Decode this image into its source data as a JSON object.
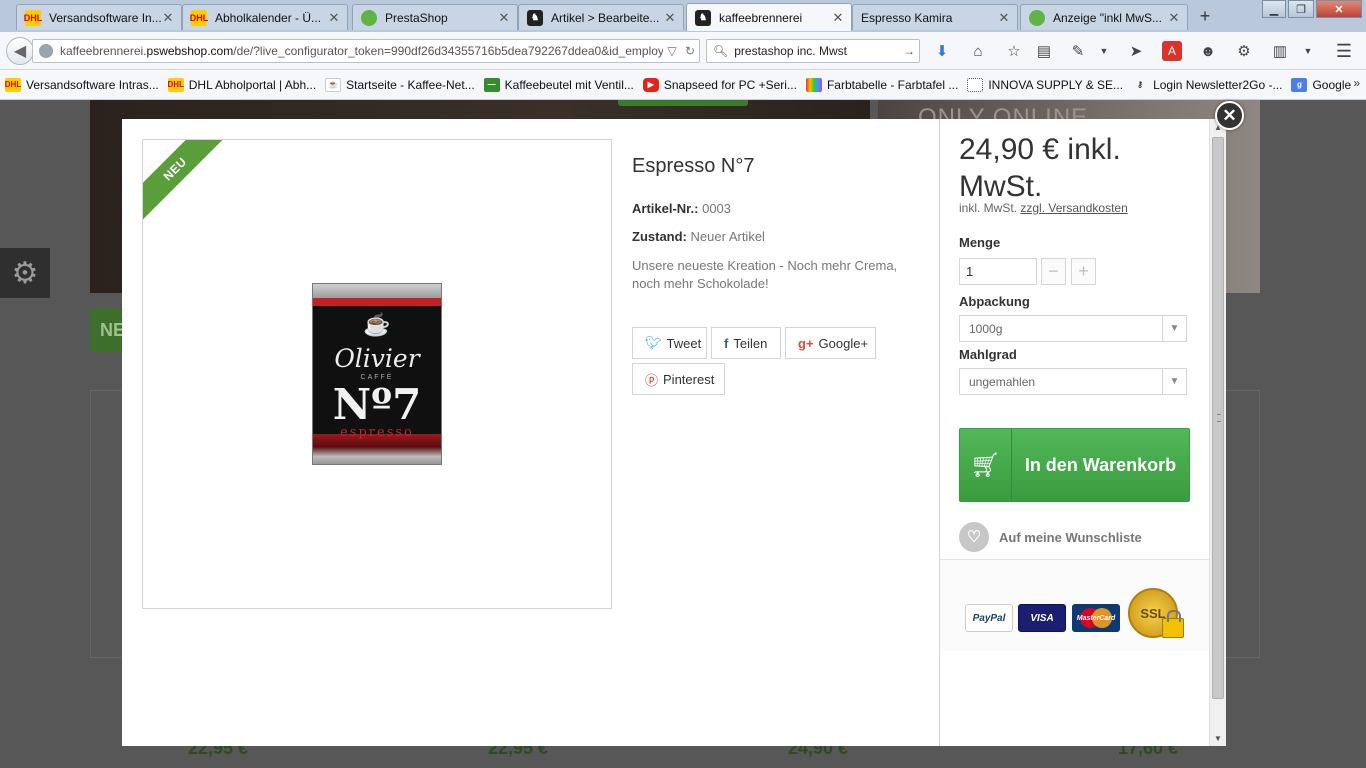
{
  "browser": {
    "tabs": [
      {
        "label": "Versandsoftware In...",
        "icon": "dhl",
        "active": false
      },
      {
        "label": "Abholkalender - Ü...",
        "icon": "dhl",
        "active": false
      },
      {
        "label": "PrestaShop",
        "icon": "ps",
        "active": false
      },
      {
        "label": "Artikel > Bearbeite...",
        "icon": "kb",
        "active": false
      },
      {
        "label": "kaffeebrennerei",
        "icon": "kb",
        "active": true
      },
      {
        "label": "Espresso Kamira",
        "icon": "",
        "active": false
      },
      {
        "label": "Anzeige \"inkl MwS...",
        "icon": "ps",
        "active": false
      }
    ],
    "url_domain": "kaffeebrennerei.",
    "url_host": "pswebshop.com",
    "url_path": "/de/?live_configurator_token=990df26d34355716b5dea792267ddea0&id_employe",
    "search_value": "prestashop inc. Mwst",
    "bookmarks": [
      {
        "label": "Versandsoftware Intras...",
        "icon": "dhl"
      },
      {
        "label": "DHL Abholportal | Abh...",
        "icon": "dhl"
      },
      {
        "label": "Startseite - Kaffee-Net...",
        "icon": "cup"
      },
      {
        "label": "Kaffeebeutel mit Ventil...",
        "icon": "grn"
      },
      {
        "label": "Snapseed for PC +Seri...",
        "icon": "yt"
      },
      {
        "label": "Farbtabelle - Farbtafel ...",
        "icon": "rb"
      },
      {
        "label": "INNOVA SUPPLY & SE...",
        "icon": "box"
      },
      {
        "label": "Login Newsletter2Go -...",
        "icon": "key"
      },
      {
        "label": "Google",
        "icon": "g"
      }
    ]
  },
  "background": {
    "online_text": "ONLY ONLINE",
    "neu_text": "NE",
    "prices": [
      "22,95 €",
      "22,95 €",
      "24,90 €",
      "17,60 €"
    ]
  },
  "product": {
    "badge": "NEU",
    "title": "Espresso N°7",
    "ref_label": "Artikel-Nr.:",
    "ref_value": "0003",
    "condition_label": "Zustand:",
    "condition_value": "Neuer Artikel",
    "description": "Unsere neueste Kreation - Noch mehr Crema, noch mehr Schokolade!",
    "tin": {
      "brand": "Olivier",
      "caffe": "CAFFÈ",
      "number": "Nº7",
      "variety": "espresso"
    },
    "share": {
      "tweet": "Tweet",
      "share": "Teilen",
      "google": "Google+",
      "pinterest": "Pinterest"
    }
  },
  "buybox": {
    "price": "24,90 € inkl. MwSt.",
    "tax_text": "inkl. MwSt.",
    "shipping_link": "zzgl. Versandkosten",
    "qty_label": "Menge",
    "qty_value": "1",
    "packaging_label": "Abpackung",
    "packaging_value": "1000g",
    "grind_label": "Mahlgrad",
    "grind_value": "ungemahlen",
    "cart_button": "In den Warenkorb",
    "wishlist": "Auf meine Wunschliste",
    "payment": {
      "paypal": "PayPal",
      "visa": "VISA",
      "mastercard": "MasterCard",
      "ssl": "SSL"
    }
  },
  "colors": {
    "accent_green": "#46a74e",
    "ribbon_green": "#5a9e3c"
  }
}
